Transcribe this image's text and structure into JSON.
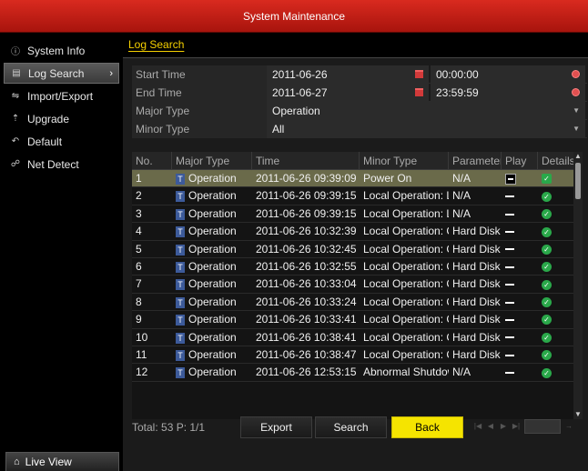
{
  "window": {
    "title": "System Maintenance"
  },
  "sidebar": {
    "items": [
      {
        "label": "System Info",
        "icon": "info-icon",
        "active": false
      },
      {
        "label": "Log Search",
        "icon": "log-search-icon",
        "active": true
      },
      {
        "label": "Import/Export",
        "icon": "import-export-icon",
        "active": false
      },
      {
        "label": "Upgrade",
        "icon": "upgrade-icon",
        "active": false
      },
      {
        "label": "Default",
        "icon": "default-icon",
        "active": false
      },
      {
        "label": "Net Detect",
        "icon": "net-detect-icon",
        "active": false
      }
    ],
    "live_view": {
      "label": "Live View",
      "icon": "home-icon"
    }
  },
  "tab": {
    "label": "Log Search"
  },
  "form": {
    "start_time": {
      "label": "Start Time",
      "date": "2011-06-26",
      "time": "00:00:00"
    },
    "end_time": {
      "label": "End Time",
      "date": "2011-06-27",
      "time": "23:59:59"
    },
    "major_type": {
      "label": "Major Type",
      "value": "Operation"
    },
    "minor_type": {
      "label": "Minor Type",
      "value": "All"
    }
  },
  "table": {
    "headers": [
      "No.",
      "Major Type",
      "Time",
      "Minor Type",
      "Parameter",
      "Play",
      "Details"
    ],
    "rows": [
      {
        "no": "1",
        "major": "Operation",
        "time": "2011-06-26 09:39:09",
        "minor": "Power On",
        "param": "N/A"
      },
      {
        "no": "2",
        "major": "Operation",
        "time": "2011-06-26 09:39:15",
        "minor": "Local Operation: L",
        "param": "N/A"
      },
      {
        "no": "3",
        "major": "Operation",
        "time": "2011-06-26 09:39:15",
        "minor": "Local Operation: L",
        "param": "N/A"
      },
      {
        "no": "4",
        "major": "Operation",
        "time": "2011-06-26 10:32:39",
        "minor": "Local Operation: C",
        "param": "Hard Disk"
      },
      {
        "no": "5",
        "major": "Operation",
        "time": "2011-06-26 10:32:45",
        "minor": "Local Operation: C",
        "param": "Hard Disk"
      },
      {
        "no": "6",
        "major": "Operation",
        "time": "2011-06-26 10:32:55",
        "minor": "Local Operation: C",
        "param": "Hard Disk"
      },
      {
        "no": "7",
        "major": "Operation",
        "time": "2011-06-26 10:33:04",
        "minor": "Local Operation: C",
        "param": "Hard Disk"
      },
      {
        "no": "8",
        "major": "Operation",
        "time": "2011-06-26 10:33:24",
        "minor": "Local Operation: C",
        "param": "Hard Disk"
      },
      {
        "no": "9",
        "major": "Operation",
        "time": "2011-06-26 10:33:41",
        "minor": "Local Operation: C",
        "param": "Hard Disk"
      },
      {
        "no": "10",
        "major": "Operation",
        "time": "2011-06-26 10:38:41",
        "minor": "Local Operation: C",
        "param": "Hard Disk"
      },
      {
        "no": "11",
        "major": "Operation",
        "time": "2011-06-26 10:38:47",
        "minor": "Local Operation: C",
        "param": "Hard Disk"
      },
      {
        "no": "12",
        "major": "Operation",
        "time": "2011-06-26 12:53:15",
        "minor": "Abnormal Shutdow",
        "param": "N/A"
      }
    ]
  },
  "footer": {
    "total": "Total: 53  P: 1/1"
  },
  "buttons": {
    "export": "Export",
    "search": "Search",
    "back": "Back"
  },
  "colors": {
    "title_bar": "#c41e16",
    "accent": "#f5d000",
    "selected_row": "#6a6a4a",
    "back_button": "#f5e400"
  }
}
